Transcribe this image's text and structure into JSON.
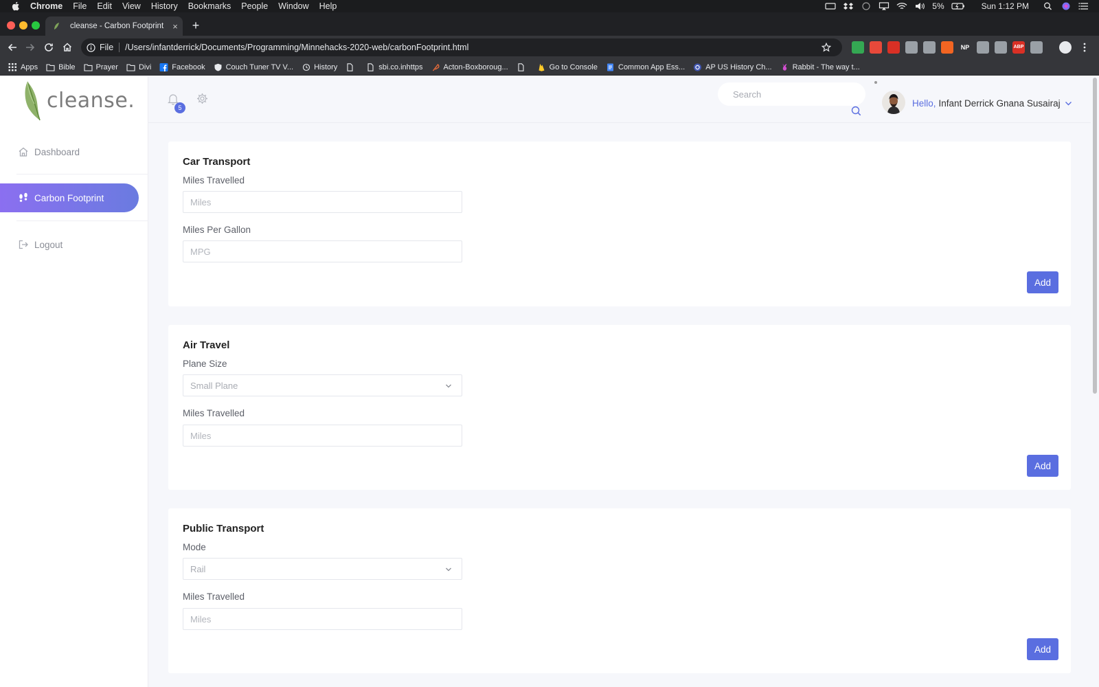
{
  "menubar": {
    "app": "Chrome",
    "items": [
      "File",
      "Edit",
      "View",
      "History",
      "Bookmarks",
      "People",
      "Window",
      "Help"
    ],
    "battery": "5%",
    "clock": "Sun 1:12 PM"
  },
  "browser": {
    "tab_title": "cleanse - Carbon Footprint",
    "tab_close": "×",
    "new_tab": "+",
    "scheme": "File",
    "url": "/Users/infantderrick/Documents/Programming/Minnehacks-2020-web/carbonFootprint.html",
    "extensions": [
      {
        "label": "",
        "color": "#34a853"
      },
      {
        "label": "",
        "color": "#e8493a"
      },
      {
        "label": "",
        "color": "#d93025"
      },
      {
        "label": "",
        "color": "#9aa0a6"
      },
      {
        "label": "",
        "color": "#9aa0a6"
      },
      {
        "label": "",
        "color": "#f26522"
      },
      {
        "label": "NP",
        "color": "#35363a"
      },
      {
        "label": "",
        "color": "#9aa0a6"
      },
      {
        "label": "",
        "color": "#9aa0a6"
      },
      {
        "label": "ABP",
        "color": "#d93025"
      },
      {
        "label": "",
        "color": "#9aa0a6"
      }
    ]
  },
  "bookmarks": [
    {
      "label": "Apps",
      "icon": "apps-grid-icon"
    },
    {
      "label": "Bible",
      "icon": "folder-icon"
    },
    {
      "label": "Prayer",
      "icon": "folder-icon"
    },
    {
      "label": "Divi",
      "icon": "folder-icon"
    },
    {
      "label": "Facebook",
      "icon": "facebook-icon"
    },
    {
      "label": "Couch Tuner TV V...",
      "icon": "shield-icon"
    },
    {
      "label": "History",
      "icon": "history-icon"
    },
    {
      "label": "",
      "icon": "page-icon"
    },
    {
      "label": "sbi.co.inhttps",
      "icon": "page-icon"
    },
    {
      "label": "Acton-Boxboroug...",
      "icon": "feather-icon"
    },
    {
      "label": "",
      "icon": "page-icon"
    },
    {
      "label": "Go to Console",
      "icon": "firebase-icon"
    },
    {
      "label": "Common App Ess...",
      "icon": "docs-icon"
    },
    {
      "label": "AP US History Ch...",
      "icon": "quizlet-icon"
    },
    {
      "label": "Rabbit - The way t...",
      "icon": "rabbit-icon"
    }
  ],
  "app": {
    "brand": "cleanse.",
    "nav": {
      "dashboard": "Dashboard",
      "carbon_footprint": "Carbon Footprint",
      "logout": "Logout"
    },
    "notifications_count": "5",
    "search_placeholder": "Search",
    "greeting": "Hello,",
    "user_name": "Infant Derrick Gnana Susairaj"
  },
  "cards": {
    "car": {
      "title": "Car Transport",
      "miles_label": "Miles Travelled",
      "miles_placeholder": "Miles",
      "mpg_label": "Miles Per Gallon",
      "mpg_placeholder": "MPG",
      "add": "Add"
    },
    "air": {
      "title": "Air Travel",
      "size_label": "Plane Size",
      "size_value": "Small Plane",
      "miles_label": "Miles Travelled",
      "miles_placeholder": "Miles",
      "add": "Add"
    },
    "public": {
      "title": "Public Transport",
      "mode_label": "Mode",
      "mode_value": "Rail",
      "miles_label": "Miles Travelled",
      "miles_placeholder": "Miles",
      "add": "Add"
    }
  },
  "colors": {
    "accent": "#5a6ee0",
    "nav_active_start": "#8b6ff0",
    "nav_active_end": "#6a7be0"
  }
}
